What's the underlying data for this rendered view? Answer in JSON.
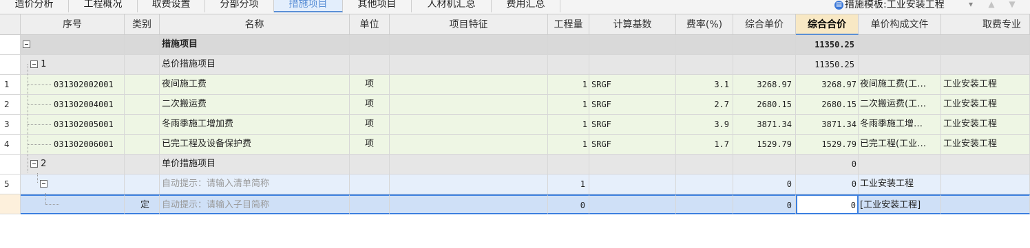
{
  "tabs": [
    {
      "label": "造价分析",
      "active": false
    },
    {
      "label": "工程概况",
      "active": false
    },
    {
      "label": "取费设置",
      "active": false
    },
    {
      "label": "分部分项",
      "active": false
    },
    {
      "label": "措施项目",
      "active": true
    },
    {
      "label": "其他项目",
      "active": false
    },
    {
      "label": "人材机汇总",
      "active": false
    },
    {
      "label": "费用汇总",
      "active": false
    }
  ],
  "template": {
    "label": "措施模板:工业安装工程",
    "icon": "template-icon"
  },
  "toolbar_icons": [
    "dropdown-icon",
    "move-up-icon",
    "move-down-icon"
  ],
  "columns": {
    "seq": "序号",
    "type": "类别",
    "name": "名称",
    "unit": "单位",
    "feature": "项目特征",
    "qty": "工程量",
    "base": "计算基数",
    "rate": "费率(%)",
    "unit_price": "综合单价",
    "total": "综合合价",
    "price_file": "单价构成文件",
    "fee_major": "取费专业"
  },
  "rows": [
    {
      "rownum": "",
      "seq": "",
      "type": "",
      "name": "措施项目",
      "unit": "",
      "feature": "",
      "qty": "",
      "base": "",
      "rate": "",
      "unit_price": "",
      "total": "11350.25",
      "price_file": "",
      "fee_major": ""
    },
    {
      "rownum": "",
      "seq": "1",
      "type": "",
      "name": "总价措施项目",
      "unit": "",
      "feature": "",
      "qty": "",
      "base": "",
      "rate": "",
      "unit_price": "",
      "total": "11350.25",
      "price_file": "",
      "fee_major": ""
    },
    {
      "rownum": "1",
      "seq": "031302002001",
      "type": "",
      "name": "夜间施工费",
      "unit": "项",
      "feature": "",
      "qty": "1",
      "base": "SRGF",
      "rate": "3.1",
      "unit_price": "3268.97",
      "total": "3268.97",
      "price_file": "夜间施工费(工…",
      "fee_major": "工业安装工程"
    },
    {
      "rownum": "2",
      "seq": "031302004001",
      "type": "",
      "name": "二次搬运费",
      "unit": "项",
      "feature": "",
      "qty": "1",
      "base": "SRGF",
      "rate": "2.7",
      "unit_price": "2680.15",
      "total": "2680.15",
      "price_file": "二次搬运费(工…",
      "fee_major": "工业安装工程"
    },
    {
      "rownum": "3",
      "seq": "031302005001",
      "type": "",
      "name": "冬雨季施工增加费",
      "unit": "项",
      "feature": "",
      "qty": "1",
      "base": "SRGF",
      "rate": "3.9",
      "unit_price": "3871.34",
      "total": "3871.34",
      "price_file": "冬雨季施工增…",
      "fee_major": "工业安装工程"
    },
    {
      "rownum": "4",
      "seq": "031302006001",
      "type": "",
      "name": "已完工程及设备保护费",
      "unit": "项",
      "feature": "",
      "qty": "1",
      "base": "SRGF",
      "rate": "1.7",
      "unit_price": "1529.79",
      "total": "1529.79",
      "price_file": "已完工程(工业…",
      "fee_major": "工业安装工程"
    },
    {
      "rownum": "",
      "seq": "2",
      "type": "",
      "name": "单价措施项目",
      "unit": "",
      "feature": "",
      "qty": "",
      "base": "",
      "rate": "",
      "unit_price": "",
      "total": "0",
      "price_file": "",
      "fee_major": ""
    },
    {
      "rownum": "5",
      "seq": "",
      "type": "",
      "name": "自动提示：请输入清单简称",
      "unit": "",
      "feature": "",
      "qty": "1",
      "base": "",
      "rate": "",
      "unit_price": "0",
      "total": "0",
      "price_file": "工业安装工程",
      "fee_major": ""
    },
    {
      "rownum": "",
      "seq": "",
      "type": "定",
      "name": "自动提示：请输入子目简称",
      "unit": "",
      "feature": "",
      "qty": "0",
      "base": "",
      "rate": "",
      "unit_price": "0",
      "total": "0",
      "price_file": "[工业安装工程]",
      "fee_major": ""
    }
  ]
}
